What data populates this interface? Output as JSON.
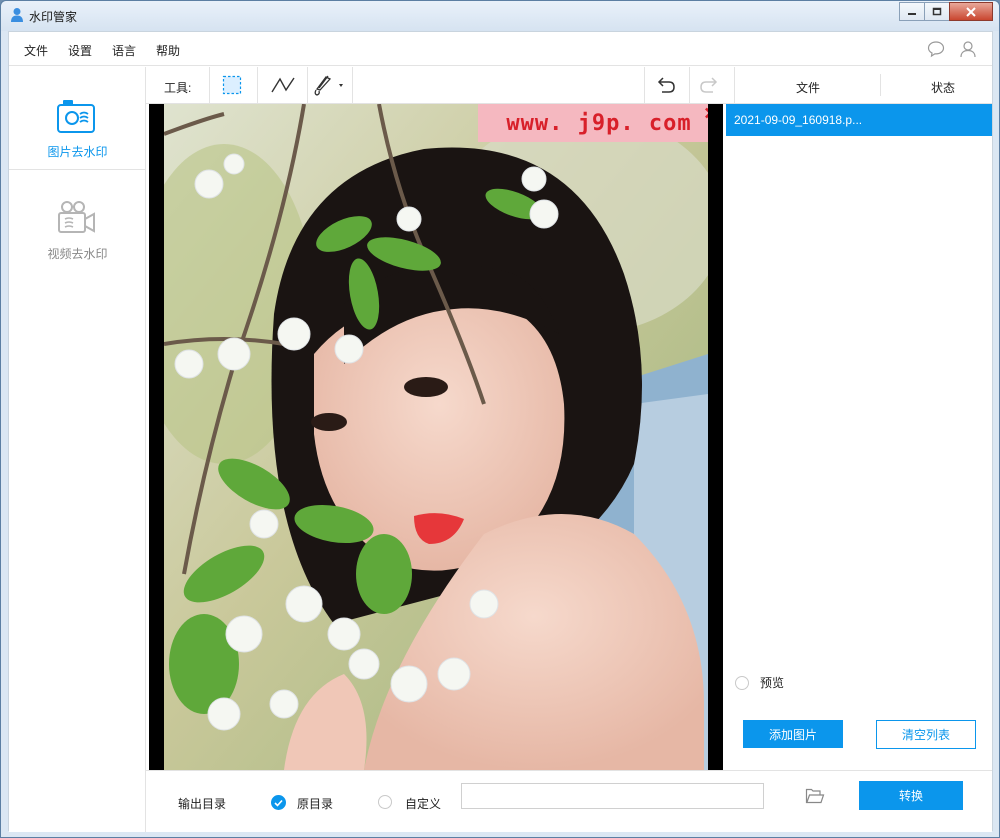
{
  "window": {
    "title": "水印管家",
    "controls": [
      "minimize-icon",
      "restore-icon",
      "close-icon"
    ]
  },
  "menu": {
    "items": [
      "文件",
      "设置",
      "语言",
      "帮助"
    ],
    "icons": [
      "chat-bubble-icon",
      "user-icon"
    ]
  },
  "sidebar": {
    "items": [
      {
        "label": "图片去水印",
        "icon": "image-remove-watermark-icon",
        "active": true
      },
      {
        "label": "视频去水印",
        "icon": "video-camera-icon",
        "active": false
      }
    ]
  },
  "toolbar": {
    "label": "工具:",
    "tools": [
      "rectangle-select-icon",
      "polyline-icon",
      "brush-icon"
    ],
    "undo_icon": "undo-icon",
    "redo_icon": "redo-icon"
  },
  "canvas": {
    "watermark_text": "www. j9p. com"
  },
  "filelist": {
    "headers": {
      "file": "文件",
      "status": "状态"
    },
    "files": [
      {
        "name": "2021-09-09_160918.p...",
        "status": ""
      }
    ],
    "preview_label": "预览",
    "add_button": "添加图片",
    "clear_button": "清空列表"
  },
  "output": {
    "label": "输出目录",
    "option_original": "原目录",
    "option_custom": "自定义",
    "selected": "原目录",
    "path_value": "",
    "convert_button": "转换"
  },
  "colors": {
    "accent": "#0b96ec",
    "watermark_bg": "#f5b8c0",
    "watermark_text": "#d8202a"
  }
}
